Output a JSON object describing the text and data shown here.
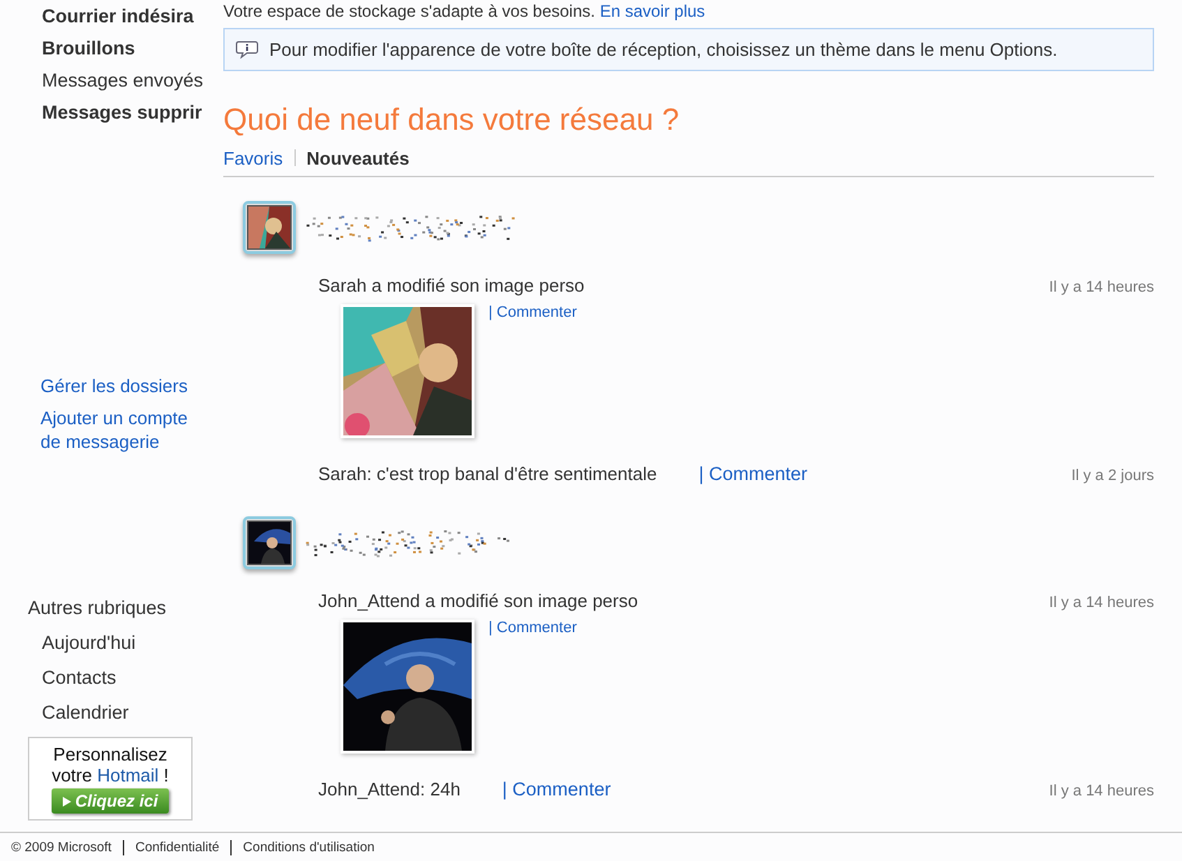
{
  "sidebar": {
    "folders": [
      {
        "label": "Courrier indésira",
        "unread": true
      },
      {
        "label": "Brouillons",
        "unread": true
      },
      {
        "label": "Messages envoyés",
        "unread": false
      },
      {
        "label": "Messages supprir",
        "unread": true
      }
    ],
    "links": [
      "Gérer les dossiers",
      "Ajouter un compte de messagerie"
    ],
    "other_heading": "Autres rubriques",
    "other_items": [
      "Aujourd'hui",
      "Contacts",
      "Calendrier"
    ],
    "promo": {
      "line_1": "Personnalisez",
      "line_2_before": "votre",
      "line_2_link": "Hotmail",
      "line_2_after": "!",
      "button": "Cliquez ici"
    }
  },
  "storage_notice": {
    "text": "Votre espace de stockage s'adapte à vos besoins.",
    "link": "En savoir plus"
  },
  "info_bar": {
    "text": "Pour modifier l'apparence de votre boîte de réception, choisissez un thème dans le menu Options."
  },
  "heading": "Quoi de neuf dans votre réseau ?",
  "tabs": [
    {
      "label": "Favoris",
      "selected": false
    },
    {
      "label": "Nouveautés",
      "selected": true
    }
  ],
  "feed": [
    {
      "activities": [
        {
          "text": "Sarah a modifié son image perso",
          "comment": "| Commenter",
          "time": "Il y a 14 heures"
        },
        {
          "kind": "status",
          "text": "Sarah: c'est trop banal d'être sentimentale",
          "comment": "| Commenter",
          "time": "Il y a 2 jours"
        }
      ]
    },
    {
      "activities": [
        {
          "text": "John_Attend a modifié son image perso",
          "comment": "| Commenter",
          "time": "Il y a 14 heures"
        },
        {
          "kind": "status",
          "text": "John_Attend: 24h",
          "comment": "| Commenter",
          "time": "Il y a 14 heures"
        }
      ]
    }
  ],
  "footer": [
    "© 2009 Microsoft",
    "Confidentialité",
    "Conditions d'utilisation"
  ]
}
